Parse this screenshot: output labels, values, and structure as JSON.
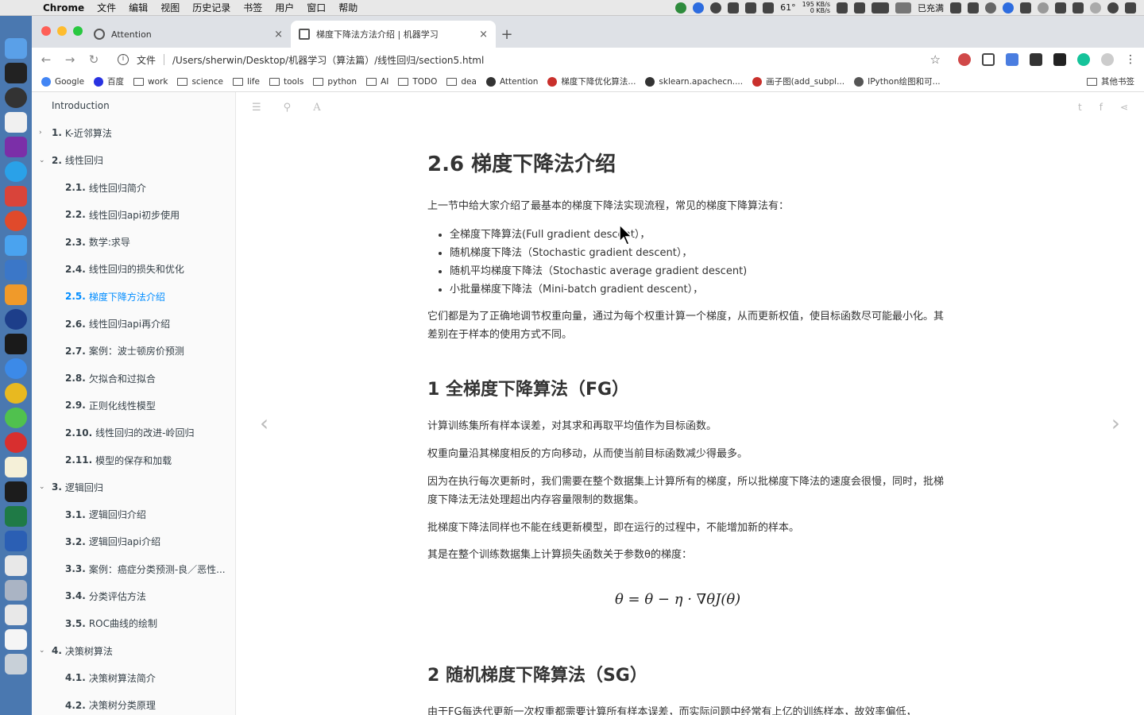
{
  "menubar": {
    "app": "Chrome",
    "menus": [
      "文件",
      "编辑",
      "视图",
      "历史记录",
      "书签",
      "用户",
      "窗口",
      "帮助"
    ],
    "temperature": "61°",
    "net_up": "195 KB/s",
    "net_down": "0 KB/s",
    "battery": "已充满"
  },
  "tabs": [
    {
      "title": "Attention",
      "close": "×"
    },
    {
      "title": "梯度下降法方法介绍 | 机器学习 ",
      "close": "×"
    }
  ],
  "newtab": "+",
  "omnibox": {
    "scheme_label": "文件",
    "url": "/Users/sherwin/Desktop/机器学习（算法篇）/线性回归/section5.html"
  },
  "bookmarks": [
    {
      "label": "Google",
      "kind": "site",
      "color": "#4285f4"
    },
    {
      "label": "百度",
      "kind": "site",
      "color": "#2932e1"
    },
    {
      "label": "work",
      "kind": "folder"
    },
    {
      "label": "science",
      "kind": "folder"
    },
    {
      "label": "life",
      "kind": "folder"
    },
    {
      "label": "tools",
      "kind": "folder"
    },
    {
      "label": "python",
      "kind": "folder"
    },
    {
      "label": "AI",
      "kind": "folder"
    },
    {
      "label": "TODO",
      "kind": "folder"
    },
    {
      "label": "dea",
      "kind": "folder"
    },
    {
      "label": "Attention",
      "kind": "site",
      "color": "#333333"
    },
    {
      "label": "梯度下降优化算法...",
      "kind": "site",
      "color": "#c9302c"
    },
    {
      "label": "sklearn.apachecn....",
      "kind": "site",
      "color": "#333333"
    },
    {
      "label": "画子图(add_subpl...",
      "kind": "site",
      "color": "#c9302c"
    },
    {
      "label": "IPython绘图和可...",
      "kind": "site",
      "color": "#555555"
    }
  ],
  "other_bookmarks": "其他书签",
  "sidebar": [
    {
      "num": "",
      "label": "Introduction",
      "level": 0,
      "chevron": ""
    },
    {
      "num": "1.",
      "label": "K-近邻算法",
      "level": 0,
      "chevron": "›"
    },
    {
      "num": "2.",
      "label": "线性回归",
      "level": 0,
      "chevron": "⌄"
    },
    {
      "num": "2.1.",
      "label": "线性回归简介",
      "level": 1
    },
    {
      "num": "2.2.",
      "label": "线性回归api初步使用",
      "level": 1
    },
    {
      "num": "2.3.",
      "label": "数学:求导",
      "level": 1
    },
    {
      "num": "2.4.",
      "label": "线性回归的损失和优化",
      "level": 1
    },
    {
      "num": "2.5.",
      "label": "梯度下降方法介绍",
      "level": 1,
      "active": true
    },
    {
      "num": "2.6.",
      "label": "线性回归api再介绍",
      "level": 1
    },
    {
      "num": "2.7.",
      "label": "案例：波士顿房价预测",
      "level": 1
    },
    {
      "num": "2.8.",
      "label": "欠拟合和过拟合",
      "level": 1
    },
    {
      "num": "2.9.",
      "label": "正则化线性模型",
      "level": 1
    },
    {
      "num": "2.10.",
      "label": "线性回归的改进-岭回归",
      "level": 1
    },
    {
      "num": "2.11.",
      "label": "模型的保存和加载",
      "level": 1
    },
    {
      "num": "3.",
      "label": "逻辑回归",
      "level": 0,
      "chevron": "⌄"
    },
    {
      "num": "3.1.",
      "label": "逻辑回归介绍",
      "level": 1
    },
    {
      "num": "3.2.",
      "label": "逻辑回归api介绍",
      "level": 1
    },
    {
      "num": "3.3.",
      "label": "案例：癌症分类预测-良／恶性...",
      "level": 1
    },
    {
      "num": "3.4.",
      "label": "分类评估方法",
      "level": 1
    },
    {
      "num": "3.5.",
      "label": "ROC曲线的绘制",
      "level": 1
    },
    {
      "num": "4.",
      "label": "决策树算法",
      "level": 0,
      "chevron": "⌄"
    },
    {
      "num": "4.1.",
      "label": "决策树算法简介",
      "level": 1
    },
    {
      "num": "4.2.",
      "label": "决策树分类原理",
      "level": 1
    }
  ],
  "article": {
    "title": "2.6 梯度下降法介绍",
    "intro": "上一节中给大家介绍了最基本的梯度下降法实现流程，常见的梯度下降算法有：",
    "list": [
      "全梯度下降算法(Full gradient descent），",
      "随机梯度下降法（Stochastic gradient descent），",
      "随机平均梯度下降法（Stochastic average gradient descent)",
      "小批量梯度下降法（Mini-batch gradient descent），"
    ],
    "summary": "它们都是为了正确地调节权重向量，通过为每个权重计算一个梯度，从而更新权值，使目标函数尽可能最小化。其差别在于样本的使用方式不同。",
    "h_fg": "1 全梯度下降算法（FG）",
    "fg_p1": "计算训练集所有样本误差，对其求和再取平均值作为目标函数。",
    "fg_p2": "权重向量沿其梯度相反的方向移动，从而使当前目标函数减少得最多。",
    "fg_p3": "因为在执行每次更新时，我们需要在整个数据集上计算所有的梯度，所以批梯度下降法的速度会很慢，同时，批梯度下降法无法处理超出内存容量限制的数据集。",
    "fg_p4": "批梯度下降法同样也不能在线更新模型，即在运行的过程中，不能增加新的样本。",
    "fg_p5": "其是在整个训练数据集上计算损失函数关于参数θ的梯度：",
    "formula": "θ = θ − η · ∇θJ(θ)",
    "h_sg": "2 随机梯度下降算法（SG）",
    "sg_p1": "由于FG每迭代更新一次权重都需要计算所有样本误差，而实际问题中经常有上亿的训练样本，故效率偏低，"
  }
}
